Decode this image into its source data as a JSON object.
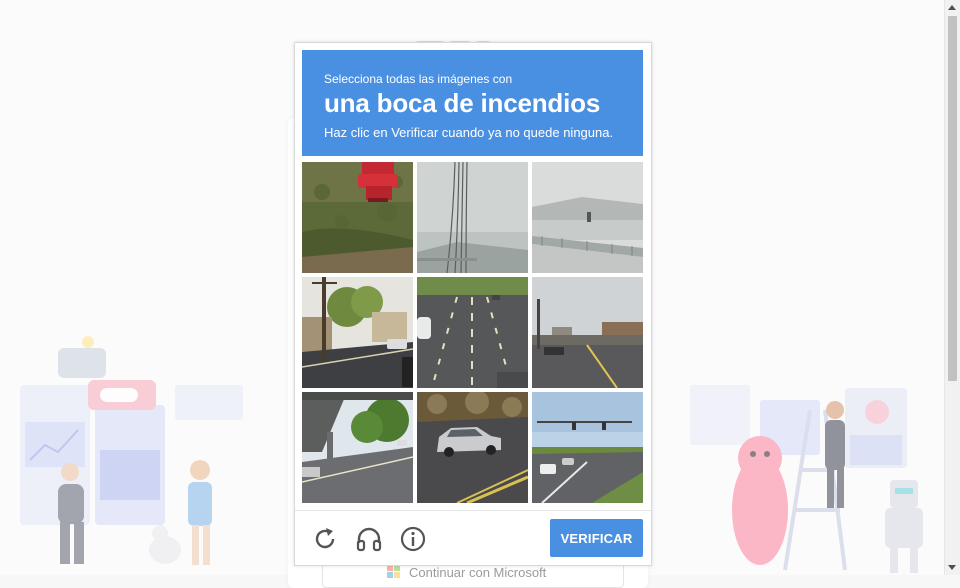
{
  "captcha": {
    "instruction_prefix": "Selecciona todas las imágenes con",
    "target_object": "una boca de incendios",
    "instruction_hint": "Haz clic en Verificar cuando ya no quede ninguna.",
    "verify_label": "VERIFICAR",
    "header_color": "#4a90e2",
    "tiles": [
      {
        "index": 1,
        "scene": "fire hydrant on grass"
      },
      {
        "index": 2,
        "scene": "foggy sky with power lines"
      },
      {
        "index": 3,
        "scene": "bridge over water in fog"
      },
      {
        "index": 4,
        "scene": "street with utility pole"
      },
      {
        "index": 5,
        "scene": "multi-lane road with cars"
      },
      {
        "index": 6,
        "scene": "wide street intersection"
      },
      {
        "index": 7,
        "scene": "underpass and trees"
      },
      {
        "index": 8,
        "scene": "silver car on road"
      },
      {
        "index": 9,
        "scene": "intersection with traffic lights"
      }
    ],
    "icons": {
      "reload": "reload-icon",
      "audio": "headphones-icon",
      "info": "info-icon"
    }
  },
  "background": {
    "microsoft_button_label": "Continuar con Microsoft"
  }
}
